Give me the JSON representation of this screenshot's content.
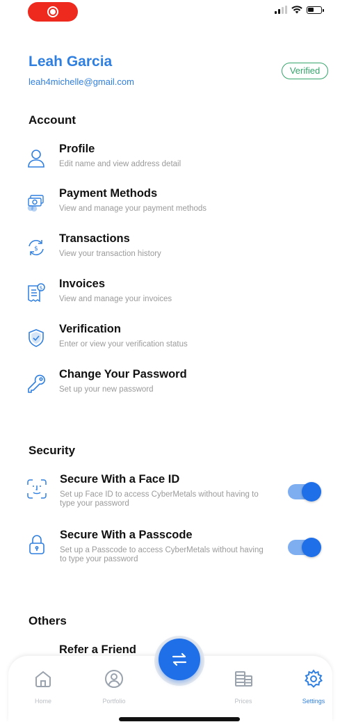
{
  "status_bar": {
    "recording": true,
    "icons": [
      "signal-icon",
      "wifi-icon",
      "battery-icon"
    ]
  },
  "user": {
    "name": "Leah Garcia",
    "email": "leah4michelle@gmail.com",
    "badge": "Verified"
  },
  "account": {
    "title": "Account",
    "items": [
      {
        "title": "Profile",
        "subtitle": "Edit name and view address detail",
        "icon": "user-icon"
      },
      {
        "title": "Payment Methods",
        "subtitle": "View and manage your payment methods",
        "icon": "cash-icon"
      },
      {
        "title": "Transactions",
        "subtitle": "View your transaction history",
        "icon": "exchange-icon"
      },
      {
        "title": "Invoices",
        "subtitle": "View and manage your invoices",
        "icon": "invoice-icon"
      },
      {
        "title": "Verification",
        "subtitle": "Enter or view your verification status",
        "icon": "shield-check-icon"
      },
      {
        "title": "Change Your Password",
        "subtitle": "Set up your new password",
        "icon": "key-icon"
      }
    ]
  },
  "security": {
    "title": "Security",
    "items": [
      {
        "title": "Secure With a Face ID",
        "subtitle": "Set up Face ID to access CyberMetals without having to type your password",
        "icon": "face-id-icon",
        "enabled": true
      },
      {
        "title": "Secure With a Passcode",
        "subtitle": "Set up a Passcode to access CyberMetals without having to type your password",
        "icon": "lock-icon",
        "enabled": true
      }
    ]
  },
  "others": {
    "title": "Others",
    "items": [
      {
        "title": "Refer a Friend"
      }
    ]
  },
  "tab_bar": {
    "tabs": [
      {
        "label": "Home",
        "icon": "home-icon",
        "active": false
      },
      {
        "label": "Portfolio",
        "icon": "portfolio-icon",
        "active": false
      },
      {
        "label": "Prices",
        "icon": "prices-icon",
        "active": false
      },
      {
        "label": "Settings",
        "icon": "gear-icon",
        "active": true
      }
    ],
    "center_action_icon": "swap-arrows-icon"
  },
  "colors": {
    "accent": "#2f7fe0",
    "verified": "#35a46b",
    "record": "#ee2a1f",
    "toggle_on": "#1f6fe8"
  }
}
